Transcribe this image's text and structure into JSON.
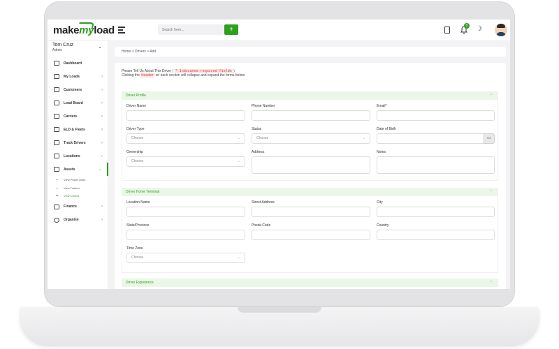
{
  "app": {
    "logo_pre": "make",
    "logo_my": "my",
    "logo_post": "load"
  },
  "header": {
    "search_placeholder": "Search here...",
    "search_button": "+",
    "notification_count": "0"
  },
  "user": {
    "name": "Tom Cruz",
    "role": "Admin"
  },
  "sidebar": {
    "items": [
      {
        "label": "Dashboard",
        "icon": "dashboard-icon"
      },
      {
        "label": "My Loads",
        "icon": "truck-arrow-icon"
      },
      {
        "label": "Customers",
        "icon": "users-icon"
      },
      {
        "label": "Load Board",
        "icon": "chart-icon"
      },
      {
        "label": "Carriers",
        "icon": "truck-icon"
      },
      {
        "label": "ELD & Fleets",
        "icon": "truck-icon"
      },
      {
        "label": "Track Drivers",
        "icon": "location-pin-icon"
      },
      {
        "label": "Locations",
        "icon": "map-pin-icon"
      },
      {
        "label": "Assets",
        "icon": "bag-icon"
      },
      {
        "label": "Finance",
        "icon": "wallet-icon"
      },
      {
        "label": "Organise",
        "icon": "target-icon"
      }
    ],
    "assets_sub": [
      "View Power Units",
      "View Trailers",
      "View Drivers"
    ]
  },
  "breadcrumb": "Home > Drivers > Add",
  "intro": {
    "line1_pre": "Please Tell Us About This Driver (",
    "line1_code": "* Indicates required fields",
    "line1_post": ")",
    "line2_pre": "Clicking the",
    "line2_code": "header",
    "line2_post": "on each section will collapse and expand the forms below."
  },
  "sections": {
    "profile": "Driver Profile",
    "home": "Driver Home Terminal",
    "experience": "Driver Experience"
  },
  "profile_fields": {
    "driver_name": "Driver Name",
    "phone": "Phone Number",
    "email": "Email*",
    "driver_type": "Driver Type",
    "status": "Status",
    "dob": "Date of Birth",
    "ownership": "Ownership",
    "address": "Address",
    "notes": "Notes",
    "choose": "Choose"
  },
  "home_fields": {
    "location_name": "Location Name",
    "street": "Street Address",
    "city": "City",
    "state": "State/Province",
    "postal": "Postal Code",
    "country": "Country",
    "timezone": "Time Zone",
    "choose": "Choose"
  },
  "colors": {
    "accent": "#2e9f1e",
    "section_bg": "#eaf7e6"
  }
}
